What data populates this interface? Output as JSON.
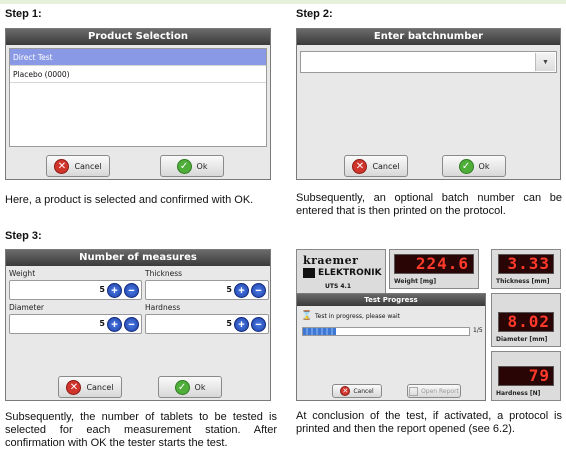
{
  "steps": {
    "s1": "Step 1:",
    "s2": "Step 2:",
    "s3": "Step 3:"
  },
  "paragraphs": {
    "p1": "Here, a product is selected and confirmed with OK.",
    "p2": "Subsequently, an optional batch number can be entered that is then printed on the protocol.",
    "p3": "Subsequently, the number of tablets to be tested is selected for each measurement station. After confirmation with OK the tester starts the test.",
    "p4": "At conclusion of the test, if activated, a protocol is printed and then the report opened (see 6.2)."
  },
  "product_dialog": {
    "title": "Product Selection",
    "items": [
      "Direct Test",
      "Placebo (0000)"
    ],
    "selected_index": 0,
    "cancel_label": "Cancel",
    "ok_label": "Ok"
  },
  "batch_dialog": {
    "title": "Enter batchnumber",
    "value": "",
    "cancel_label": "Cancel",
    "ok_label": "Ok"
  },
  "measures_dialog": {
    "title": "Number of measures",
    "fields": [
      {
        "label": "Weight",
        "value": "5"
      },
      {
        "label": "Thickness",
        "value": "5"
      },
      {
        "label": "Diameter",
        "value": "5"
      },
      {
        "label": "Hardness",
        "value": "5"
      }
    ],
    "cancel_label": "Cancel",
    "ok_label": "Ok"
  },
  "tester_screen": {
    "logo_top": "kraemer",
    "logo_sub": "ELEKTRONIK",
    "model": "UTS 4.1",
    "weight_value": "224.6",
    "weight_label": "Weight [mg]",
    "thickness_value": "3.33",
    "thickness_label": "Thickness [mm]",
    "diameter_value": "8.02",
    "diameter_label": "Diameter [mm]",
    "hardness_value": "79",
    "hardness_label": "Hardness [N]",
    "progress_title": "Test Progress",
    "progress_text": "Test in progress, please wait",
    "progress_count": "1/5",
    "progress_fraction": 0.2,
    "cancel_label": "Cancel",
    "open_report_label": "Open Report"
  },
  "colors": {
    "selection": "#8a99e6",
    "led": "#ff3a2a",
    "accent_blue": "#2e5ccc"
  }
}
